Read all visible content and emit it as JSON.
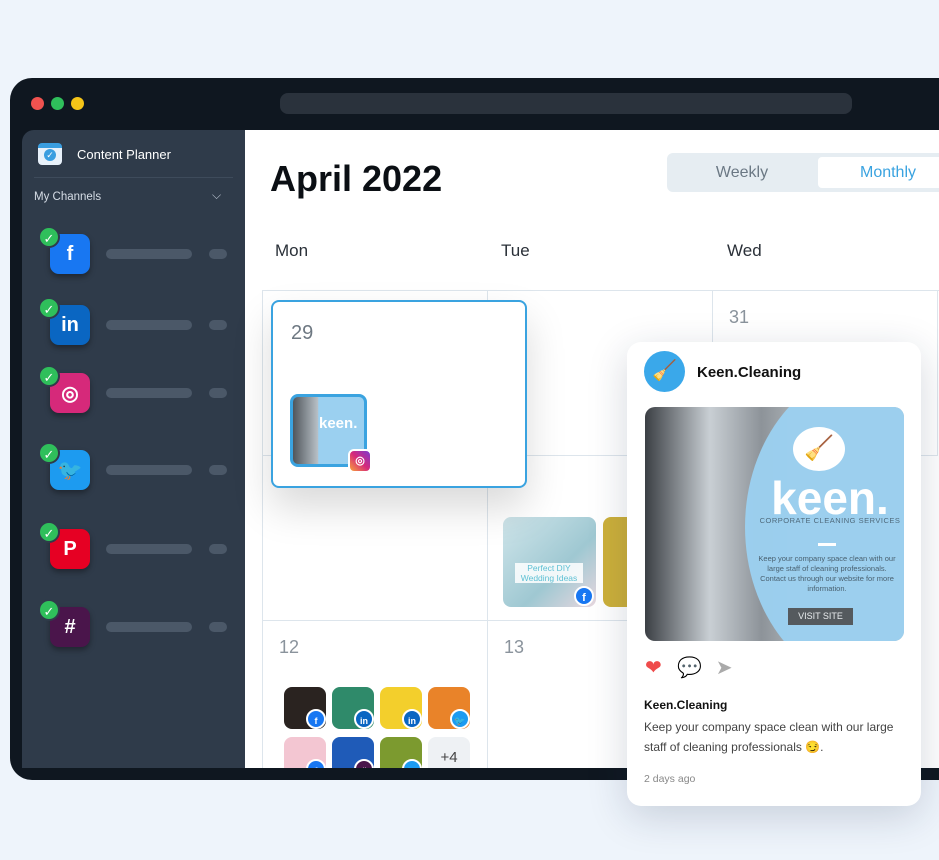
{
  "window": {
    "traffic_lights": [
      "#f0524f",
      "#2fbf5b",
      "#f5c518"
    ]
  },
  "sidebar": {
    "title": "Content Planner",
    "section": "My Channels",
    "channels": [
      {
        "icon": "facebook-icon",
        "glyph": "f",
        "color": "#1877f2",
        "connected": true
      },
      {
        "icon": "linkedin-icon",
        "glyph": "in",
        "color": "#0a66c2",
        "connected": true
      },
      {
        "icon": "instagram-icon",
        "glyph": "◎",
        "color": "#d6297a",
        "connected": true
      },
      {
        "icon": "twitter-icon",
        "glyph": "🐦",
        "color": "#1d9bf0",
        "connected": true
      },
      {
        "icon": "pinterest-icon",
        "glyph": "P",
        "color": "#e60023",
        "connected": true
      },
      {
        "icon": "slack-icon",
        "glyph": "#",
        "color": "#4a154b",
        "connected": true
      }
    ]
  },
  "main": {
    "title": "April 2022",
    "view_toggle": {
      "options": [
        "Weekly",
        "Monthly"
      ],
      "selected": "Monthly"
    },
    "days": [
      "Mon",
      "Tue",
      "Wed"
    ],
    "dates": {
      "a": "29",
      "b": "31",
      "c": "12",
      "d": "13"
    },
    "highlighted_post": {
      "thumb_text": "keen.",
      "network": "instagram"
    },
    "tue_post": {
      "text": "Perfect DIY Wedding Ideas",
      "network": "facebook"
    },
    "more_count": "+4"
  },
  "preview": {
    "account": "Keen.Cleaning",
    "image": {
      "brand": "keen.",
      "tagline": "CORPORATE CLEANING SERVICES",
      "body": "Keep your company space clean with our large staff of cleaning professionals. Contact us through our website for more information.",
      "cta": "VISIT SITE"
    },
    "actions": [
      "heart-icon",
      "comment-icon",
      "send-icon"
    ],
    "caption_author": "Keen.Cleaning",
    "caption": "Keep your company space clean with our large staff of cleaning professionals 😏.",
    "time": "2 days ago"
  }
}
